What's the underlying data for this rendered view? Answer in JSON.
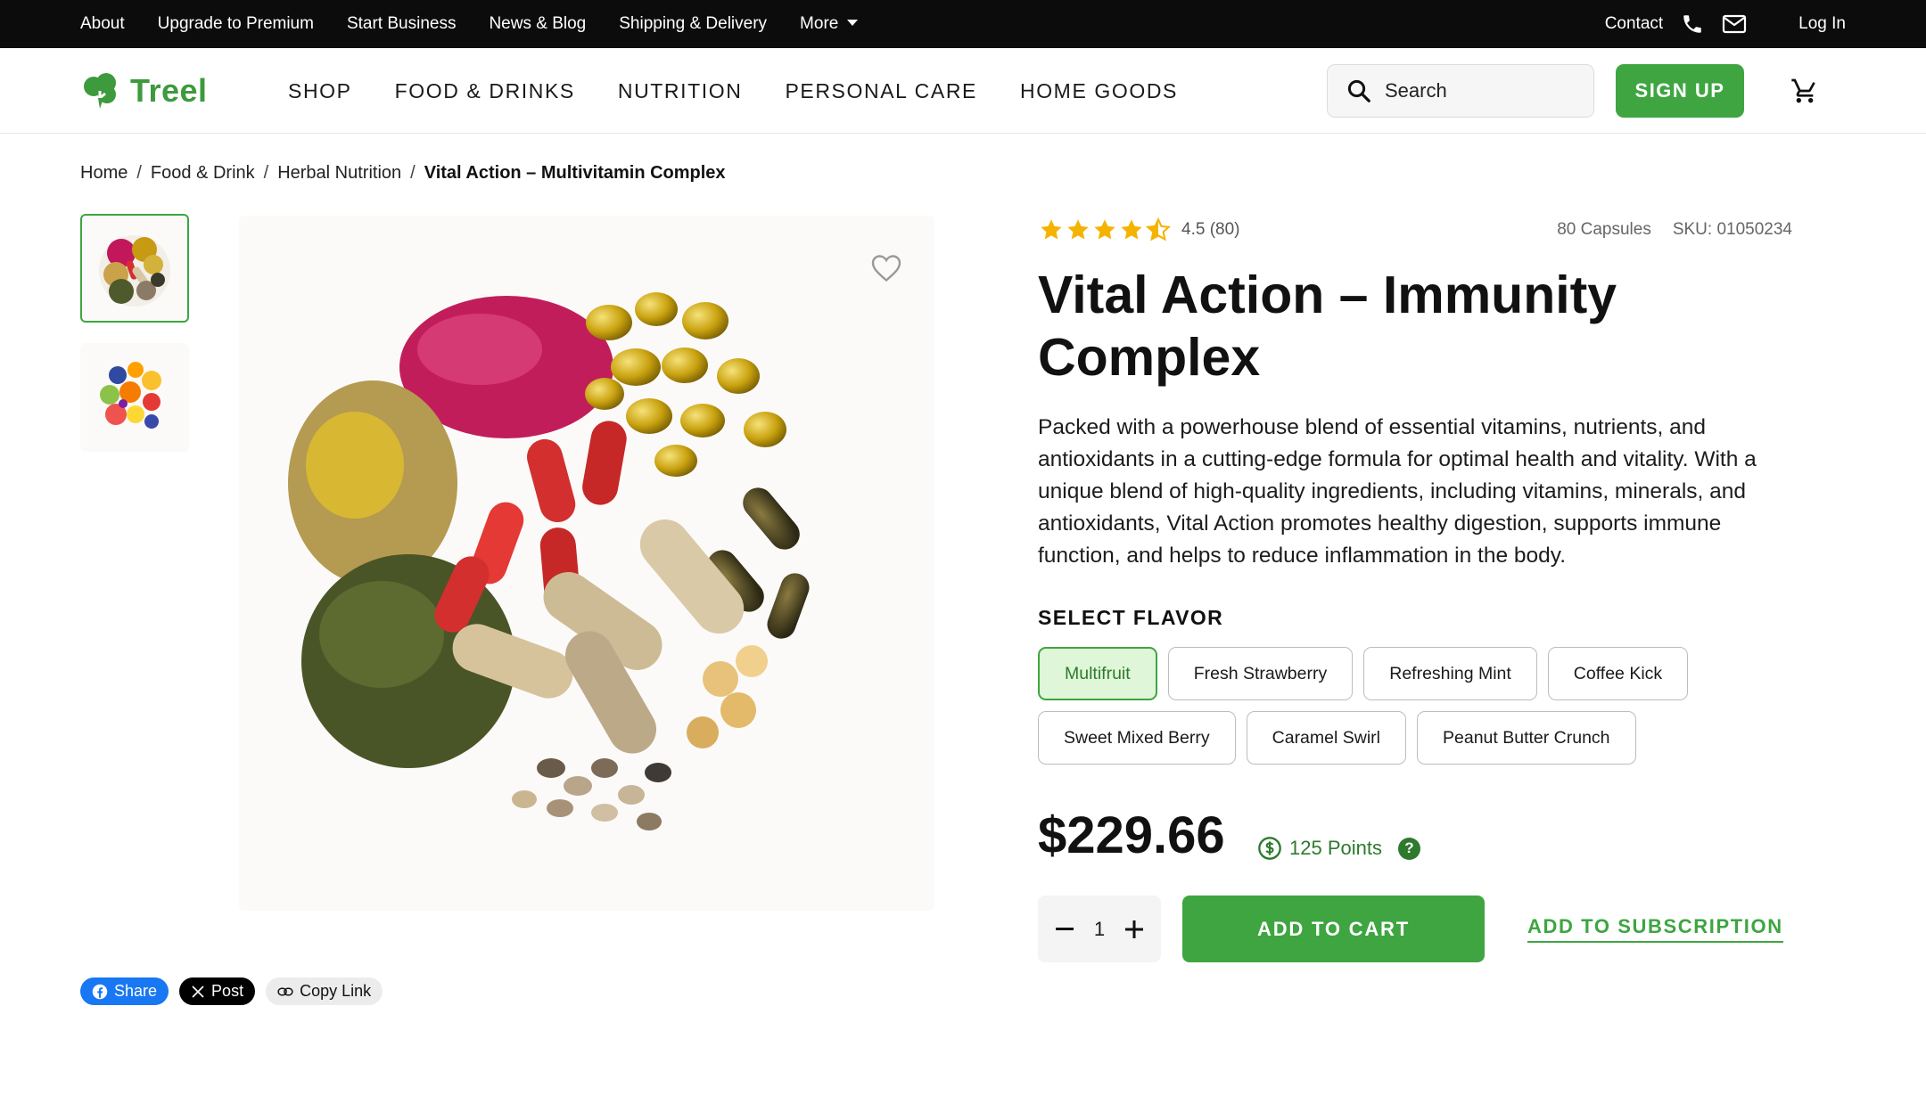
{
  "topbar": {
    "links": [
      "About",
      "Upgrade to Premium",
      "Start Business",
      "News & Blog",
      "Shipping & Delivery"
    ],
    "more_label": "More",
    "contact_label": "Contact",
    "login_label": "Log In"
  },
  "header": {
    "brand": "Treel",
    "nav": [
      "SHOP",
      "FOOD & DRINKS",
      "NUTRITION",
      "PERSONAL CARE",
      "HOME GOODS"
    ],
    "search_placeholder": "Search",
    "signup_label": "SIGN UP"
  },
  "breadcrumb": {
    "items": [
      "Home",
      "Food & Drink",
      "Herbal Nutrition"
    ],
    "current": "Vital Action – Multivitamin Complex"
  },
  "product": {
    "rating_value": 4.5,
    "rating_text": "4.5 (80)",
    "capsules": "80 Capsules",
    "sku": "SKU: 01050234",
    "title": "Vital Action – Immunity Complex",
    "description": "Packed with a powerhouse blend of essential vitamins, nutrients, and antioxidants in a cutting-edge formula for optimal health and vitality. With a unique blend of high-quality ingredients, including vitamins, minerals, and antioxidants, Vital Action promotes healthy digestion, supports immune function, and helps to reduce inflammation in the body.",
    "flavor_label": "SELECT FLAVOR",
    "flavors": [
      "Multifruit",
      "Fresh Strawberry",
      "Refreshing Mint",
      "Coffee Kick",
      "Sweet Mixed Berry",
      "Caramel Swirl",
      "Peanut Butter Crunch"
    ],
    "selected_flavor": "Multifruit",
    "price": "$229.66",
    "points": "125 Points",
    "points_help": "?",
    "quantity": "1",
    "add_to_cart": "ADD TO CART",
    "add_to_subscription": "ADD TO SUBSCRIPTION"
  },
  "share": {
    "facebook": "Share",
    "x": "Post",
    "copy": "Copy Link"
  },
  "colors": {
    "accent_green": "#3ea541",
    "dark_green": "#2d7a2d",
    "selected_bg": "#dff7d8",
    "star": "#f5b301",
    "topbar_bg": "#0c0c0c",
    "facebook_blue": "#1877f2"
  },
  "icons": [
    "phone-icon",
    "mail-icon",
    "search-icon",
    "cart-icon",
    "heart-icon",
    "star-icon",
    "coin-icon",
    "link-icon",
    "facebook-icon",
    "x-icon",
    "minus-icon",
    "plus-icon",
    "logo-icon"
  ]
}
